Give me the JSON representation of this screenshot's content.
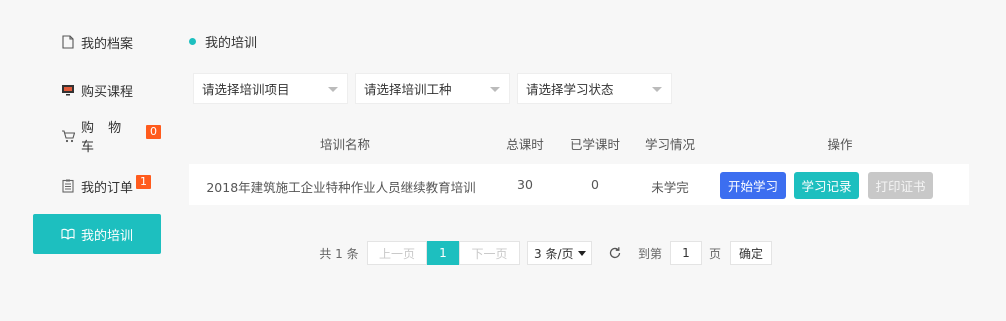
{
  "sidebar": {
    "items": [
      {
        "label": "我的档案",
        "icon": "document-icon"
      },
      {
        "label": "购买课程",
        "icon": "monitor-icon"
      },
      {
        "label": "购 物 车",
        "icon": "cart-icon",
        "badge": "0"
      },
      {
        "label": "我的订单",
        "icon": "orders-icon",
        "badge": "1"
      },
      {
        "label": "我的培训",
        "icon": "book-icon",
        "active": true
      }
    ],
    "active_color": "#1dbfbf",
    "badge_color": "#ff5b1d"
  },
  "main": {
    "title": "我的培训",
    "filters": {
      "project": "请选择培训项目",
      "job_type": "请选择培训工种",
      "status": "请选择学习状态"
    },
    "table": {
      "headers": [
        "培训名称",
        "总课时",
        "已学课时",
        "学习情况",
        "操作"
      ],
      "rows": [
        {
          "name": "2018年建筑施工企业特种作业人员继续教育培训",
          "total_hours": "30",
          "learned_hours": "0",
          "status": "未学完",
          "actions": {
            "start": "开始学习",
            "record": "学习记录",
            "print": "打印证书"
          }
        }
      ]
    },
    "pagination": {
      "total": "共 1 条",
      "prev": "上一页",
      "current": "1",
      "next": "下一页",
      "page_size": "3 条/页",
      "goto_label": "到第",
      "goto_value": "1",
      "page_unit": "页",
      "confirm": "确定"
    }
  },
  "colors": {
    "accent": "#1dbfbf",
    "primary_button": "#3c6ef0",
    "disabled_button": "#c8c8c8"
  }
}
